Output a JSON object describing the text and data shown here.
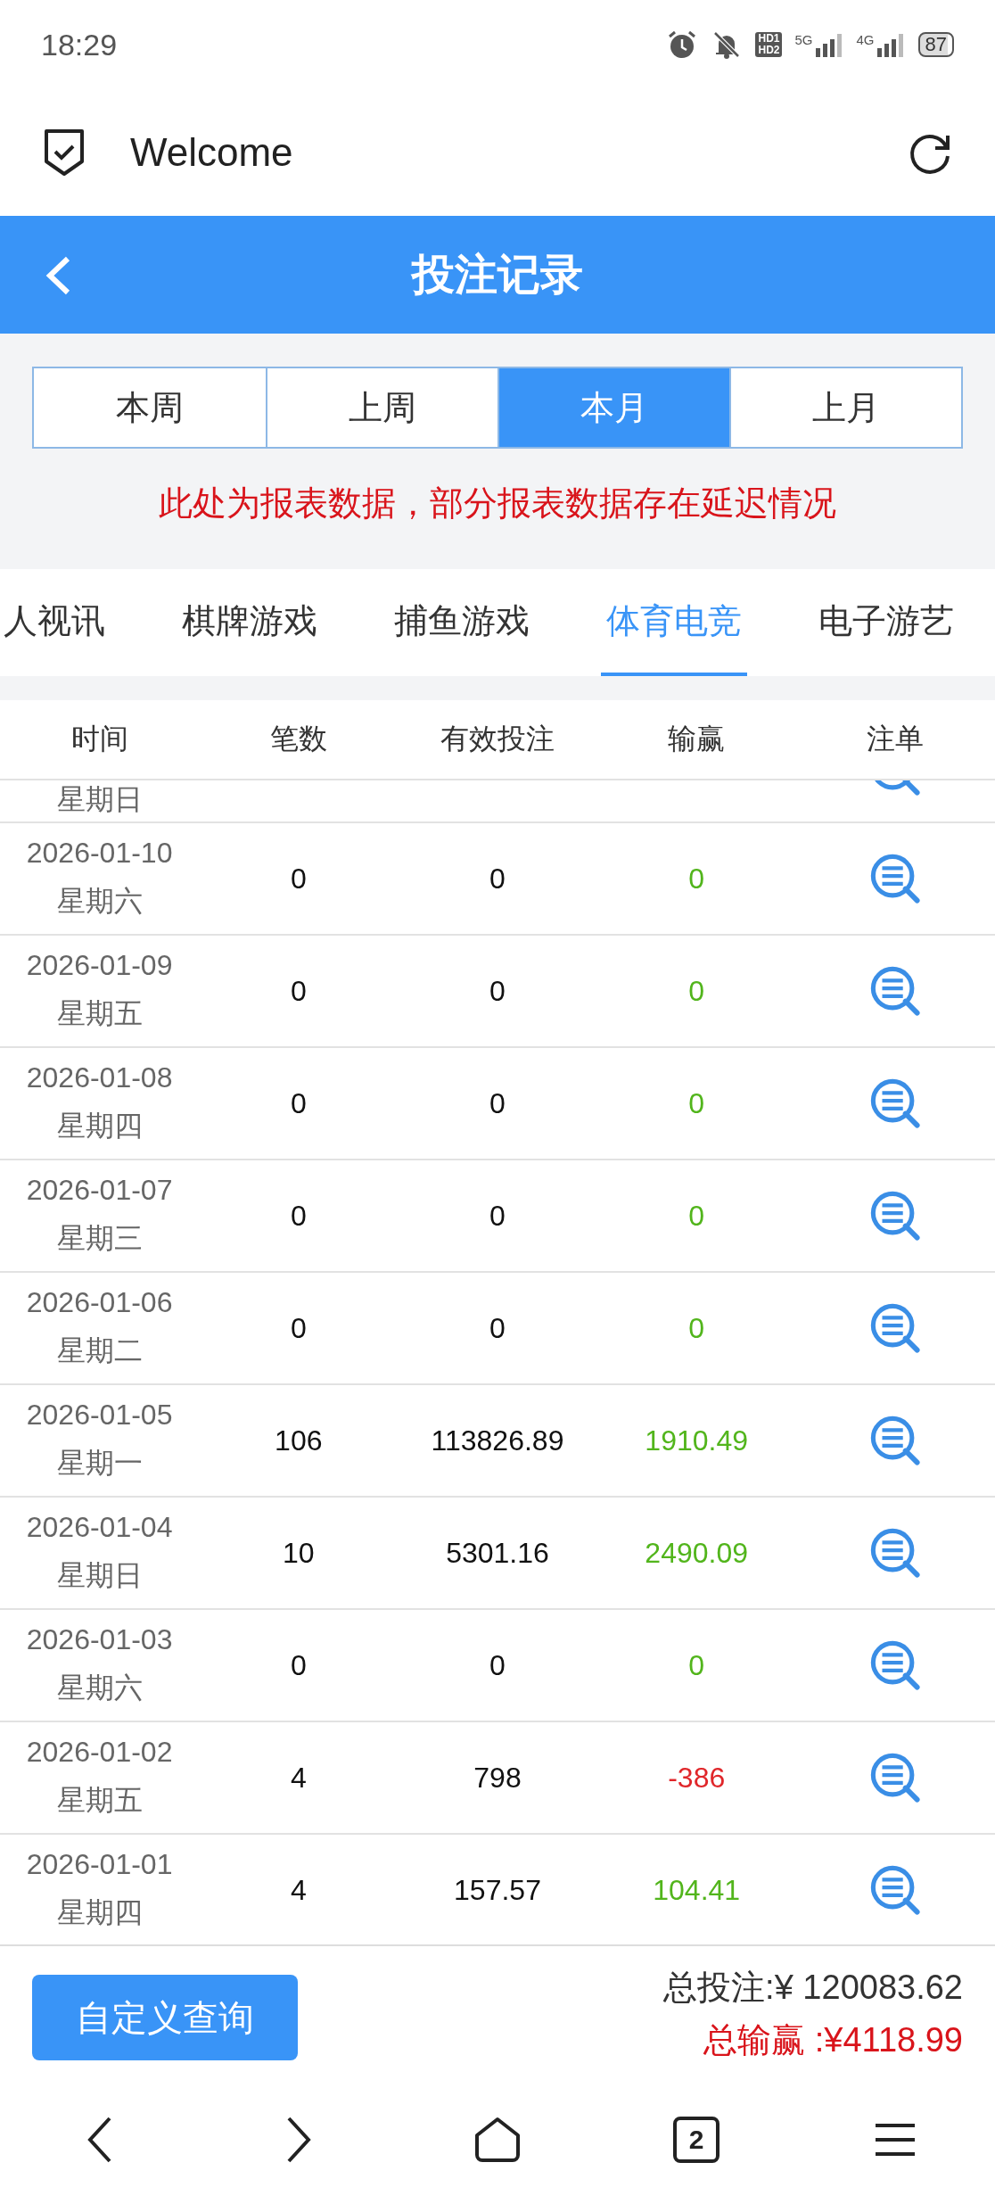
{
  "status_bar": {
    "time": "18:29",
    "hd_labels": [
      "HD1",
      "HD2"
    ],
    "networks": [
      "5G",
      "4G"
    ],
    "battery": "87"
  },
  "browser": {
    "title": "Welcome"
  },
  "header": {
    "title": "投注记录"
  },
  "period_tabs": [
    {
      "label": "本周",
      "selected": false
    },
    {
      "label": "上周",
      "selected": false
    },
    {
      "label": "本月",
      "selected": true
    },
    {
      "label": "上月",
      "selected": false
    }
  ],
  "notice": "此处为报表数据，部分报表数据存在延迟情况",
  "category_tabs": [
    {
      "label": "人视讯",
      "selected": false
    },
    {
      "label": "棋牌游戏",
      "selected": false
    },
    {
      "label": "捕鱼游戏",
      "selected": false
    },
    {
      "label": "体育电竞",
      "selected": true
    },
    {
      "label": "电子游艺",
      "selected": false
    }
  ],
  "table": {
    "columns": [
      "时间",
      "笔数",
      "有效投注",
      "输赢",
      "注单"
    ],
    "partial_row": {
      "weekday": "星期日"
    },
    "rows": [
      {
        "date": "2026-01-10",
        "weekday": "星期六",
        "count": "0",
        "stake": "0",
        "result": "0",
        "kind": "gain"
      },
      {
        "date": "2026-01-09",
        "weekday": "星期五",
        "count": "0",
        "stake": "0",
        "result": "0",
        "kind": "gain"
      },
      {
        "date": "2026-01-08",
        "weekday": "星期四",
        "count": "0",
        "stake": "0",
        "result": "0",
        "kind": "gain"
      },
      {
        "date": "2026-01-07",
        "weekday": "星期三",
        "count": "0",
        "stake": "0",
        "result": "0",
        "kind": "gain"
      },
      {
        "date": "2026-01-06",
        "weekday": "星期二",
        "count": "0",
        "stake": "0",
        "result": "0",
        "kind": "gain"
      },
      {
        "date": "2026-01-05",
        "weekday": "星期一",
        "count": "106",
        "stake": "113826.89",
        "result": "1910.49",
        "kind": "gain"
      },
      {
        "date": "2026-01-04",
        "weekday": "星期日",
        "count": "10",
        "stake": "5301.16",
        "result": "2490.09",
        "kind": "gain"
      },
      {
        "date": "2026-01-03",
        "weekday": "星期六",
        "count": "0",
        "stake": "0",
        "result": "0",
        "kind": "gain"
      },
      {
        "date": "2026-01-02",
        "weekday": "星期五",
        "count": "4",
        "stake": "798",
        "result": "-386",
        "kind": "loss"
      },
      {
        "date": "2026-01-01",
        "weekday": "星期四",
        "count": "4",
        "stake": "157.57",
        "result": "104.41",
        "kind": "gain"
      }
    ]
  },
  "footer": {
    "button": "自定义查询",
    "total_stake": "总投注:¥ 120083.62",
    "total_result": "总输赢 :¥4118.99"
  },
  "nav": {
    "tab_count": "2"
  }
}
